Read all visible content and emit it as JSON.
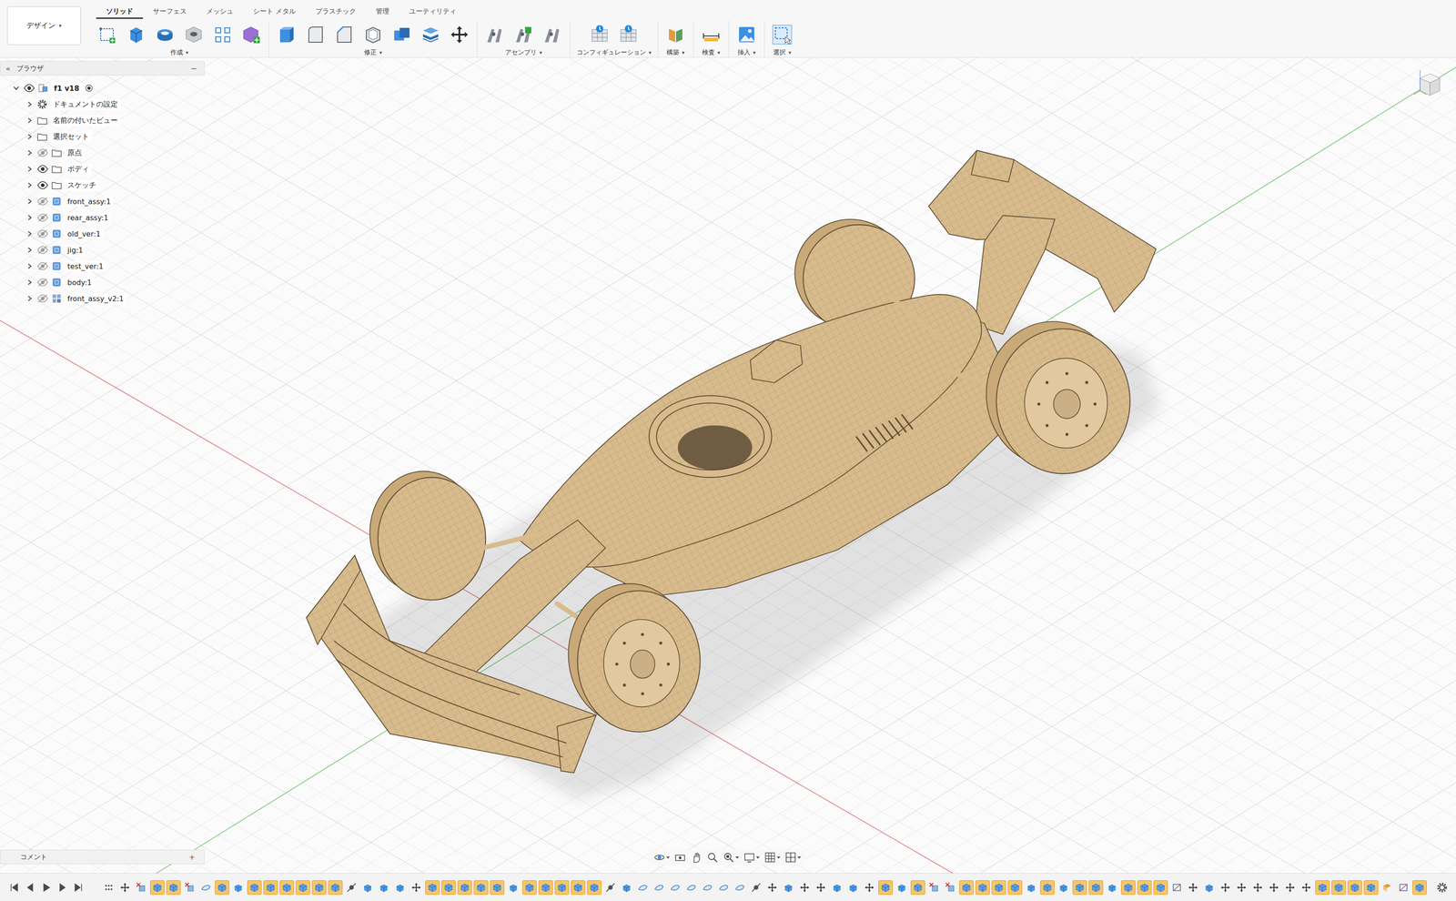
{
  "workspace": {
    "label": "デザイン",
    "caret": "▾"
  },
  "tabs": [
    {
      "label": "ソリッド",
      "selected": true
    },
    {
      "label": "サーフェス",
      "selected": false
    },
    {
      "label": "メッシュ",
      "selected": false
    },
    {
      "label": "シート メタル",
      "selected": false
    },
    {
      "label": "プラスチック",
      "selected": false
    },
    {
      "label": "管理",
      "selected": false
    },
    {
      "label": "ユーティリティ",
      "selected": false
    }
  ],
  "tool_groups": [
    {
      "label": "作成",
      "caret": "▾"
    },
    {
      "label": "修正",
      "caret": "▾"
    },
    {
      "label": "アセンブリ",
      "caret": "▾"
    },
    {
      "label": "コンフィギュレーション",
      "caret": "▾"
    },
    {
      "label": "構築",
      "caret": "▾"
    },
    {
      "label": "検査",
      "caret": "▾"
    },
    {
      "label": "挿入",
      "caret": "▾"
    },
    {
      "label": "選択",
      "caret": "▾"
    }
  ],
  "browser": {
    "collapse": "«",
    "title": "ブラウザ",
    "minimize": "−",
    "items": [
      {
        "label": "f1 v18",
        "kind": "root",
        "level": 0,
        "expanded": true,
        "visibility": "shown",
        "active": true
      },
      {
        "label": "ドキュメントの設定",
        "kind": "settings",
        "level": 1,
        "expanded": false,
        "visibility": "none",
        "active": false
      },
      {
        "label": "名前の付いたビュー",
        "kind": "folder",
        "level": 1,
        "expanded": false,
        "visibility": "none",
        "active": false
      },
      {
        "label": "選択セット",
        "kind": "folder",
        "level": 1,
        "expanded": false,
        "visibility": "none",
        "active": false
      },
      {
        "label": "原点",
        "kind": "folder",
        "level": 1,
        "expanded": false,
        "visibility": "hidden",
        "active": false
      },
      {
        "label": "ボディ",
        "kind": "folder",
        "level": 1,
        "expanded": false,
        "visibility": "shown",
        "active": false
      },
      {
        "label": "スケッチ",
        "kind": "folder",
        "level": 1,
        "expanded": false,
        "visibility": "shown",
        "active": false
      },
      {
        "label": "front_assy:1",
        "kind": "component",
        "level": 1,
        "expanded": false,
        "visibility": "hidden",
        "active": false
      },
      {
        "label": "rear_assy:1",
        "kind": "component",
        "level": 1,
        "expanded": false,
        "visibility": "hidden",
        "active": false
      },
      {
        "label": "old_ver:1",
        "kind": "component",
        "level": 1,
        "expanded": false,
        "visibility": "hidden",
        "active": false
      },
      {
        "label": "jig:1",
        "kind": "component",
        "level": 1,
        "expanded": false,
        "visibility": "hidden",
        "active": false
      },
      {
        "label": "test_ver:1",
        "kind": "component",
        "level": 1,
        "expanded": false,
        "visibility": "hidden",
        "active": false
      },
      {
        "label": "body:1",
        "kind": "component",
        "level": 1,
        "expanded": false,
        "visibility": "hidden",
        "active": false
      },
      {
        "label": "front_assy_v2:1",
        "kind": "assembly",
        "level": 1,
        "expanded": false,
        "visibility": "hidden",
        "active": false
      }
    ]
  },
  "comments": {
    "title": "コメント",
    "add": "+"
  },
  "timeline": {
    "features": [
      {
        "kind": "group",
        "highlighted": false
      },
      {
        "kind": "move",
        "highlighted": false
      },
      {
        "kind": "delete",
        "highlighted": false
      },
      {
        "kind": "component",
        "highlighted": true
      },
      {
        "kind": "component",
        "highlighted": true
      },
      {
        "kind": "delete",
        "highlighted": false
      },
      {
        "kind": "form",
        "highlighted": false
      },
      {
        "kind": "component",
        "highlighted": true
      },
      {
        "kind": "extrude",
        "highlighted": false
      },
      {
        "kind": "component",
        "highlighted": true
      },
      {
        "kind": "component",
        "highlighted": true
      },
      {
        "kind": "component",
        "highlighted": true
      },
      {
        "kind": "component",
        "highlighted": true
      },
      {
        "kind": "component",
        "highlighted": true
      },
      {
        "kind": "component",
        "highlighted": true
      },
      {
        "kind": "joint",
        "highlighted": false
      },
      {
        "kind": "extrude",
        "highlighted": false
      },
      {
        "kind": "extrude",
        "highlighted": false
      },
      {
        "kind": "extrude",
        "highlighted": false
      },
      {
        "kind": "move",
        "highlighted": false
      },
      {
        "kind": "component",
        "highlighted": true
      },
      {
        "kind": "component",
        "highlighted": true
      },
      {
        "kind": "component",
        "highlighted": true
      },
      {
        "kind": "component",
        "highlighted": true
      },
      {
        "kind": "component",
        "highlighted": true
      },
      {
        "kind": "extrude",
        "highlighted": false
      },
      {
        "kind": "component",
        "highlighted": true
      },
      {
        "kind": "component",
        "highlighted": true
      },
      {
        "kind": "component",
        "highlighted": true
      },
      {
        "kind": "component",
        "highlighted": true
      },
      {
        "kind": "component",
        "highlighted": true
      },
      {
        "kind": "joint",
        "highlighted": false
      },
      {
        "kind": "extrude",
        "highlighted": false
      },
      {
        "kind": "form",
        "highlighted": false
      },
      {
        "kind": "form",
        "highlighted": false
      },
      {
        "kind": "form",
        "highlighted": false
      },
      {
        "kind": "form",
        "highlighted": false
      },
      {
        "kind": "form",
        "highlighted": false
      },
      {
        "kind": "form",
        "highlighted": false
      },
      {
        "kind": "form",
        "highlighted": false
      },
      {
        "kind": "joint",
        "highlighted": false
      },
      {
        "kind": "move",
        "highlighted": false
      },
      {
        "kind": "extrude",
        "highlighted": false
      },
      {
        "kind": "move",
        "highlighted": false
      },
      {
        "kind": "move",
        "highlighted": false
      },
      {
        "kind": "extrude",
        "highlighted": false
      },
      {
        "kind": "extrude",
        "highlighted": false
      },
      {
        "kind": "move",
        "highlighted": false
      },
      {
        "kind": "component",
        "highlighted": true
      },
      {
        "kind": "extrude",
        "highlighted": false
      },
      {
        "kind": "component",
        "highlighted": true
      },
      {
        "kind": "delete",
        "highlighted": false
      },
      {
        "kind": "delete",
        "highlighted": false
      },
      {
        "kind": "component",
        "highlighted": true
      },
      {
        "kind": "component",
        "highlighted": true
      },
      {
        "kind": "component",
        "highlighted": true
      },
      {
        "kind": "component",
        "highlighted": true
      },
      {
        "kind": "extrude",
        "highlighted": false
      },
      {
        "kind": "component",
        "highlighted": true
      },
      {
        "kind": "extrude",
        "highlighted": false
      },
      {
        "kind": "component",
        "highlighted": true
      },
      {
        "kind": "component",
        "highlighted": true
      },
      {
        "kind": "extrude",
        "highlighted": false
      },
      {
        "kind": "component",
        "highlighted": true
      },
      {
        "kind": "component",
        "highlighted": true
      },
      {
        "kind": "component",
        "highlighted": true
      },
      {
        "kind": "sketch",
        "highlighted": false
      },
      {
        "kind": "move",
        "highlighted": false
      },
      {
        "kind": "extrude",
        "highlighted": false
      },
      {
        "kind": "move",
        "highlighted": false
      },
      {
        "kind": "move",
        "highlighted": false
      },
      {
        "kind": "move",
        "highlighted": false
      },
      {
        "kind": "move",
        "highlighted": false
      },
      {
        "kind": "move",
        "highlighted": false
      },
      {
        "kind": "move",
        "highlighted": false
      },
      {
        "kind": "component",
        "highlighted": true
      },
      {
        "kind": "component",
        "highlighted": true
      },
      {
        "kind": "component",
        "highlighted": true
      },
      {
        "kind": "component",
        "highlighted": true
      },
      {
        "kind": "plane",
        "highlighted": false
      },
      {
        "kind": "sketch",
        "highlighted": false
      },
      {
        "kind": "component",
        "highlighted": true
      }
    ]
  }
}
